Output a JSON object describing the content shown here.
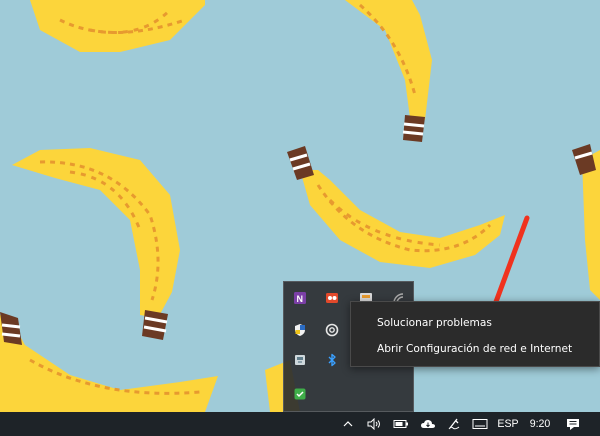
{
  "wallpaper": {
    "background": "#9fcbd8",
    "banana": "#fcd53b",
    "stripe": "#e79a2f",
    "stem": "#6b3a24"
  },
  "tray_flyout": {
    "icons": [
      "onenote-icon",
      "screen-recorder-icon",
      "file-manager-icon",
      "windows-security-icon",
      "circular-app-icon",
      "bluetooth-icon",
      "usb-drive-icon",
      "green-check-shield-icon",
      "rss-icon"
    ]
  },
  "context_menu": {
    "items": [
      {
        "label": "Solucionar problemas"
      },
      {
        "label": "Abrir Configuración de red e Internet"
      }
    ]
  },
  "annotation": {
    "color": "#f0321e"
  },
  "taskbar": {
    "icons": [
      "chevron-up-icon",
      "volume-icon",
      "battery-icon",
      "cloud-sync-icon",
      "pen-icon",
      "touch-keyboard-icon",
      "notification-icon"
    ],
    "language": "ESP",
    "time": "9:20"
  }
}
